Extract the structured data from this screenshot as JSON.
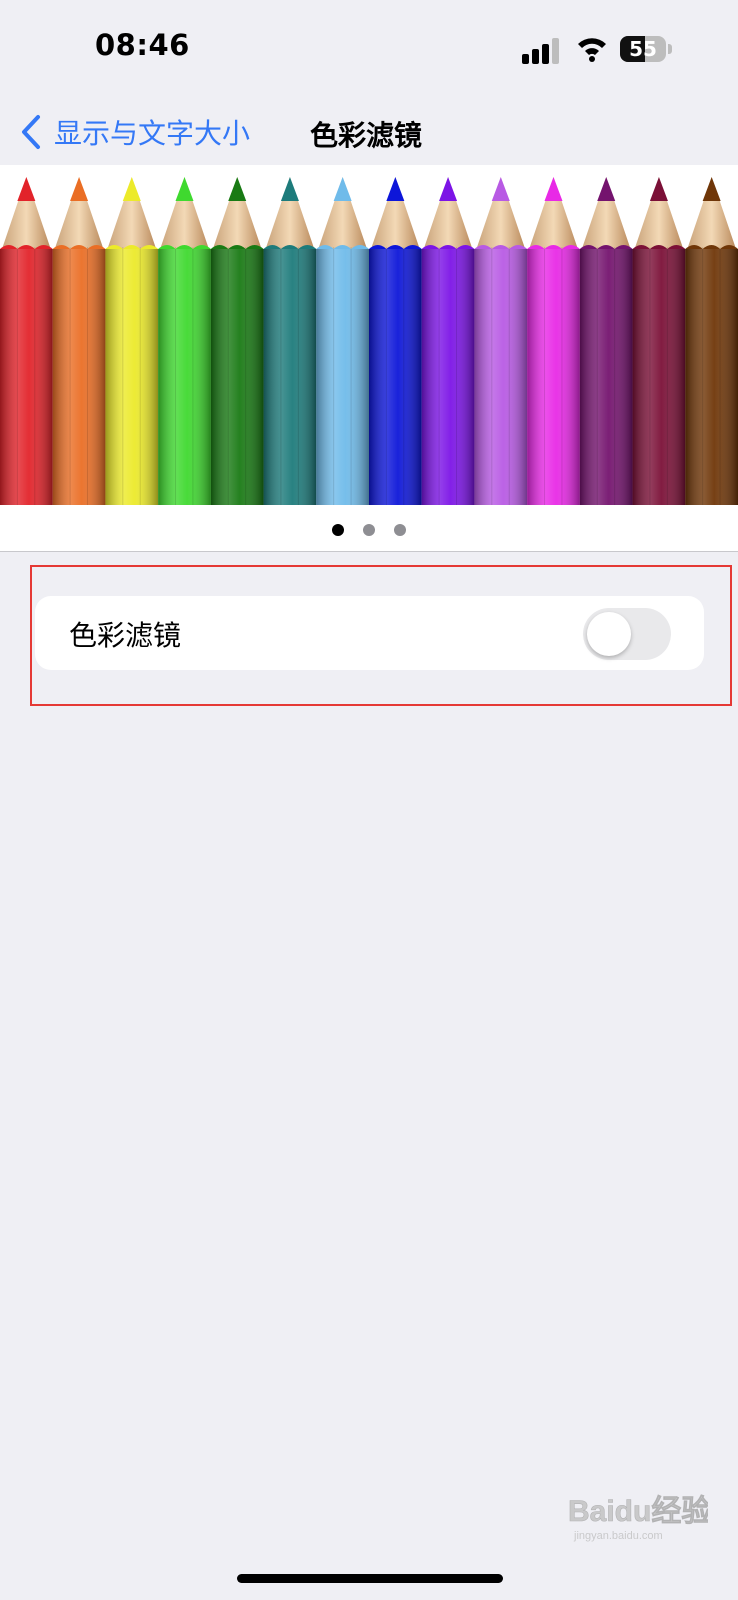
{
  "status_bar": {
    "time": "08:46",
    "battery_level": "55",
    "battery_percent": 55,
    "signal_icon": "cellular-signal-icon",
    "wifi_icon": "wifi-icon"
  },
  "nav": {
    "back_label": "显示与文字大小",
    "title": "色彩滤镜",
    "back_icon": "chevron-left-icon",
    "accent_color": "#3478f6"
  },
  "banner": {
    "image": "colored-pencils",
    "pencil_colors": [
      "#e2232a",
      "#ea6e25",
      "#ecea2a",
      "#3fd92f",
      "#197a14",
      "#1d7b7b",
      "#6fbbea",
      "#0d16d9",
      "#7c14e6",
      "#b85ae4",
      "#e829e6",
      "#74136e",
      "#7b1037",
      "#6f3608"
    ],
    "page_count": 3,
    "current_page": 1
  },
  "settings": {
    "color_filters_label": "色彩滤镜",
    "color_filters_enabled": false
  },
  "watermark": {
    "text": "Baidu经验",
    "subtext": "jingyan.baidu.com"
  }
}
